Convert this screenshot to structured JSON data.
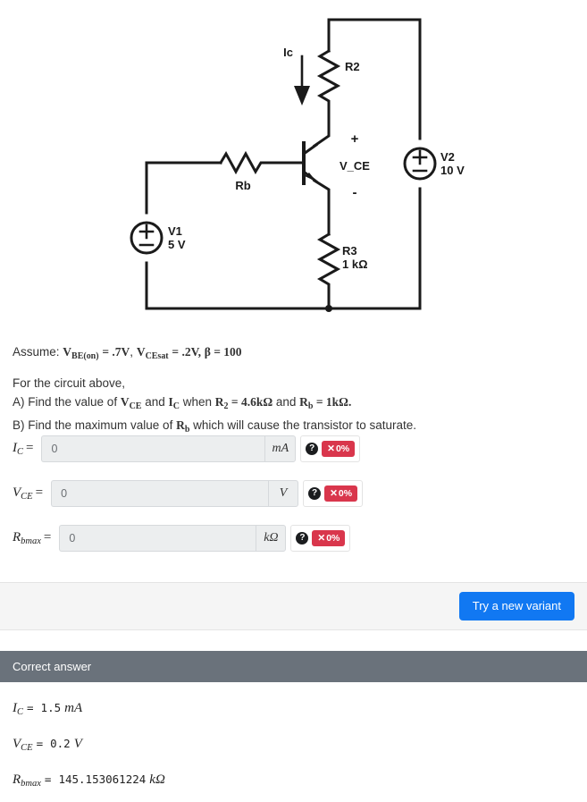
{
  "circuit": {
    "labels": {
      "ic": "Ic",
      "r2": "R2",
      "rb": "Rb",
      "r3_name": "R3",
      "r3_value": "1 kΩ",
      "v1_name": "V1",
      "v1_value": "5 V",
      "v2_name": "V2",
      "v2_value": "10 V",
      "vce": "V_CE",
      "plus": "+",
      "minus": "-"
    }
  },
  "assume": {
    "prefix": "Assume:",
    "vbe_var": "V",
    "vbe_sub": "BE(on)",
    "vbe_val": "= .7V",
    "comma": ",",
    "vcesat_var": "V",
    "vcesat_sub": "CEsat",
    "vcesat_val": "= .2V,",
    "beta": "β = 100"
  },
  "question": {
    "intro": "For the circuit above,",
    "part_a_pre": "A) Find the value of ",
    "part_a_v": "V",
    "part_a_v_sub": "CE",
    "part_a_mid": " and ",
    "part_a_i": "I",
    "part_a_i_sub": "C",
    "part_a_when": " when ",
    "part_a_r2": "R",
    "part_a_r2_sub": "2",
    "part_a_r2_val": " = 4.6kΩ",
    "part_a_and": " and ",
    "part_a_rb": "R",
    "part_a_rb_sub": "b",
    "part_a_rb_val": " = 1kΩ.",
    "part_b_pre": "B) Find the maximum value of ",
    "part_b_rb": "R",
    "part_b_rb_sub": "b",
    "part_b_post": " which will cause the transistor to saturate."
  },
  "rows": [
    {
      "id": "ic",
      "label_var": "I",
      "label_sub": "C",
      "label_eq": "=",
      "value": "0",
      "placeholder": "0",
      "unit": "mA",
      "help": "?",
      "score_mark": "✕",
      "score_pct": "0%"
    },
    {
      "id": "vce",
      "label_var": "V",
      "label_sub": "CE",
      "label_eq": "=",
      "value": "0",
      "placeholder": "0",
      "unit": "V",
      "help": "?",
      "score_mark": "✕",
      "score_pct": "0%"
    },
    {
      "id": "rb",
      "label_var": "R",
      "label_sub": "bmax",
      "label_eq": "=",
      "value": "0",
      "placeholder": "0",
      "unit": "kΩ",
      "help": "?",
      "score_mark": "✕",
      "score_pct": "0%"
    }
  ],
  "footer": {
    "variant_button": "Try a new variant"
  },
  "correct_answer": {
    "header": "Correct answer",
    "lines": [
      {
        "var": "I",
        "sub": "C",
        "eq": "=",
        "value": "1.5",
        "unit": "mA"
      },
      {
        "var": "V",
        "sub": "CE",
        "eq": "=",
        "value": "0.2",
        "unit": "V"
      },
      {
        "var": "R",
        "sub": "bmax",
        "eq": "=",
        "value": "145.153061224",
        "unit": "kΩ"
      }
    ]
  },
  "colors": {
    "accent_blue": "#1178f2",
    "badge_red": "#d9364c",
    "panel_header_gray": "#6a727b",
    "field_gray": "#eceeef"
  }
}
